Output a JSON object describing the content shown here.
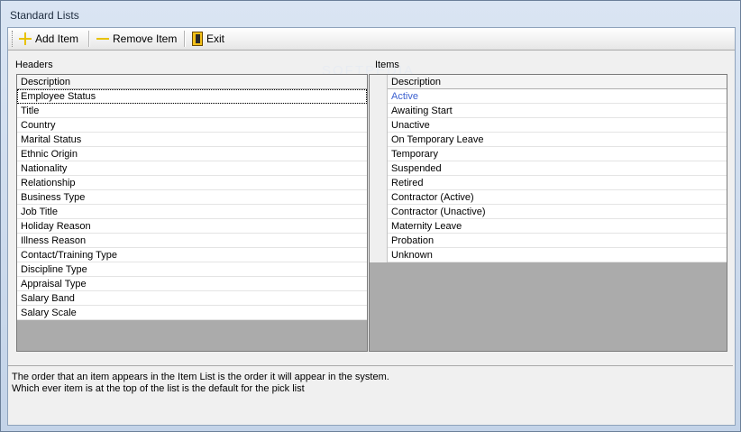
{
  "window": {
    "title": "Standard Lists"
  },
  "toolbar": {
    "add_label": "Add Item",
    "remove_label": "Remove Item",
    "exit_label": "Exit"
  },
  "headers_panel": {
    "label": "Headers",
    "column": "Description",
    "rows": [
      "Employee Status",
      "Title",
      "Country",
      "Marital Status",
      "Ethnic Origin",
      "Nationality",
      "Relationship",
      "Business Type",
      "Job Title",
      "Holiday Reason",
      "Illness Reason",
      "Contact/Training Type",
      "Discipline Type",
      "Appraisal Type",
      "Salary Band",
      "Salary Scale"
    ]
  },
  "items_panel": {
    "label": "Items",
    "column": "Description",
    "rows": [
      "Active",
      "Awaiting Start",
      "Unactive",
      "On Temporary Leave",
      "Temporary",
      "Suspended",
      "Retired",
      "Contractor (Active)",
      "Contractor (Unactive)",
      "Maternity Leave",
      "Probation",
      "Unknown"
    ]
  },
  "info": {
    "line1": "The order that an item appears in the Item List is the order it will appear in the system.",
    "line2": "Which ever item is at the top of the list is the default for the pick list"
  },
  "watermark": "SOFTPEDIA",
  "colors": {
    "selected_text": "#3b5fcf",
    "empty_grid": "#ababab"
  }
}
